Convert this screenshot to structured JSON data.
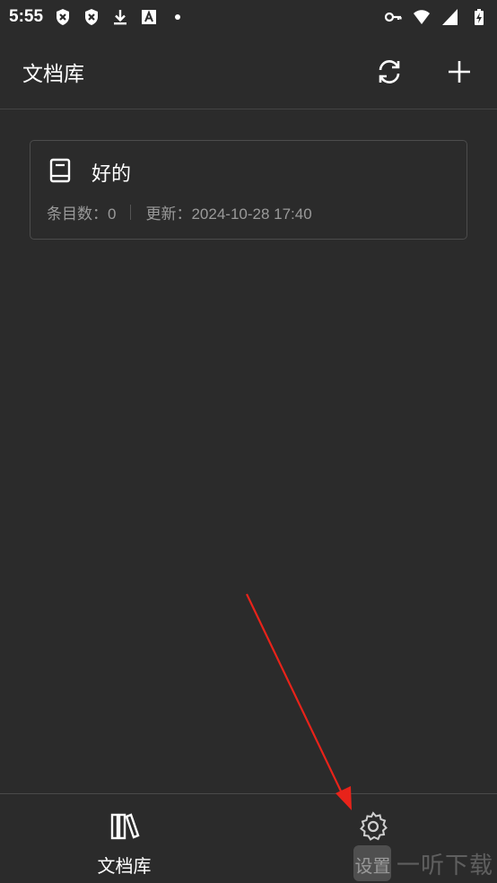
{
  "status_bar": {
    "time": "5:55",
    "left_icons": [
      "shield-x-icon",
      "shield-x-icon",
      "download-icon",
      "font-a-icon",
      "dot-icon"
    ],
    "right_icons": [
      "vpn-key-icon",
      "wifi-icon",
      "signal-icon",
      "battery-charging-icon"
    ]
  },
  "app_bar": {
    "title": "文档库",
    "actions": [
      "sync-icon",
      "add-icon"
    ]
  },
  "documents": [
    {
      "title": "好的",
      "count_label": "条目数：0",
      "updated_label": "更新：2024-10-28 17:40",
      "icon": "book-icon"
    }
  ],
  "bottom_nav": {
    "items": [
      {
        "label": "文档库",
        "icon": "library-icon",
        "active": true
      },
      {
        "label": "设置",
        "icon": "gear-icon",
        "active": false
      }
    ]
  },
  "annotation": {
    "arrow_color": "#e8231a"
  },
  "watermark": {
    "text": "一听下载"
  },
  "colors": {
    "background": "#2b2b2b",
    "card_border": "#4c4c4c",
    "meta_text": "#9a9a9a",
    "divider": "#444444"
  }
}
